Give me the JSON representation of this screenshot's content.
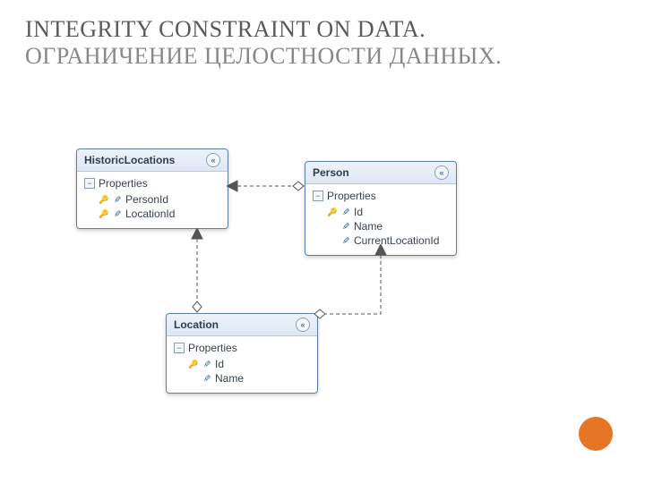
{
  "title_line1": " INTEGRITY CONSTRAINT ON DATA.",
  "title_line2": "ОГРАНИЧЕНИЕ ЦЕЛОСТНОСТИ ДАННЫХ.",
  "collapse_glyph": "−",
  "chevron_glyph": "«",
  "entities": {
    "historic": {
      "name": "HistoricLocations",
      "section": "Properties",
      "props": [
        {
          "key": true,
          "name": "PersonId"
        },
        {
          "key": true,
          "name": "LocationId"
        }
      ]
    },
    "person": {
      "name": "Person",
      "section": "Properties",
      "props": [
        {
          "key": true,
          "name": "Id"
        },
        {
          "key": false,
          "name": "Name"
        },
        {
          "key": false,
          "name": "CurrentLocationId"
        }
      ]
    },
    "location": {
      "name": "Location",
      "section": "Properties",
      "props": [
        {
          "key": true,
          "name": "Id"
        },
        {
          "key": false,
          "name": "Name"
        }
      ]
    }
  },
  "icons": {
    "key": "🔑",
    "prop": "✎"
  },
  "accent_color": "#e67526"
}
